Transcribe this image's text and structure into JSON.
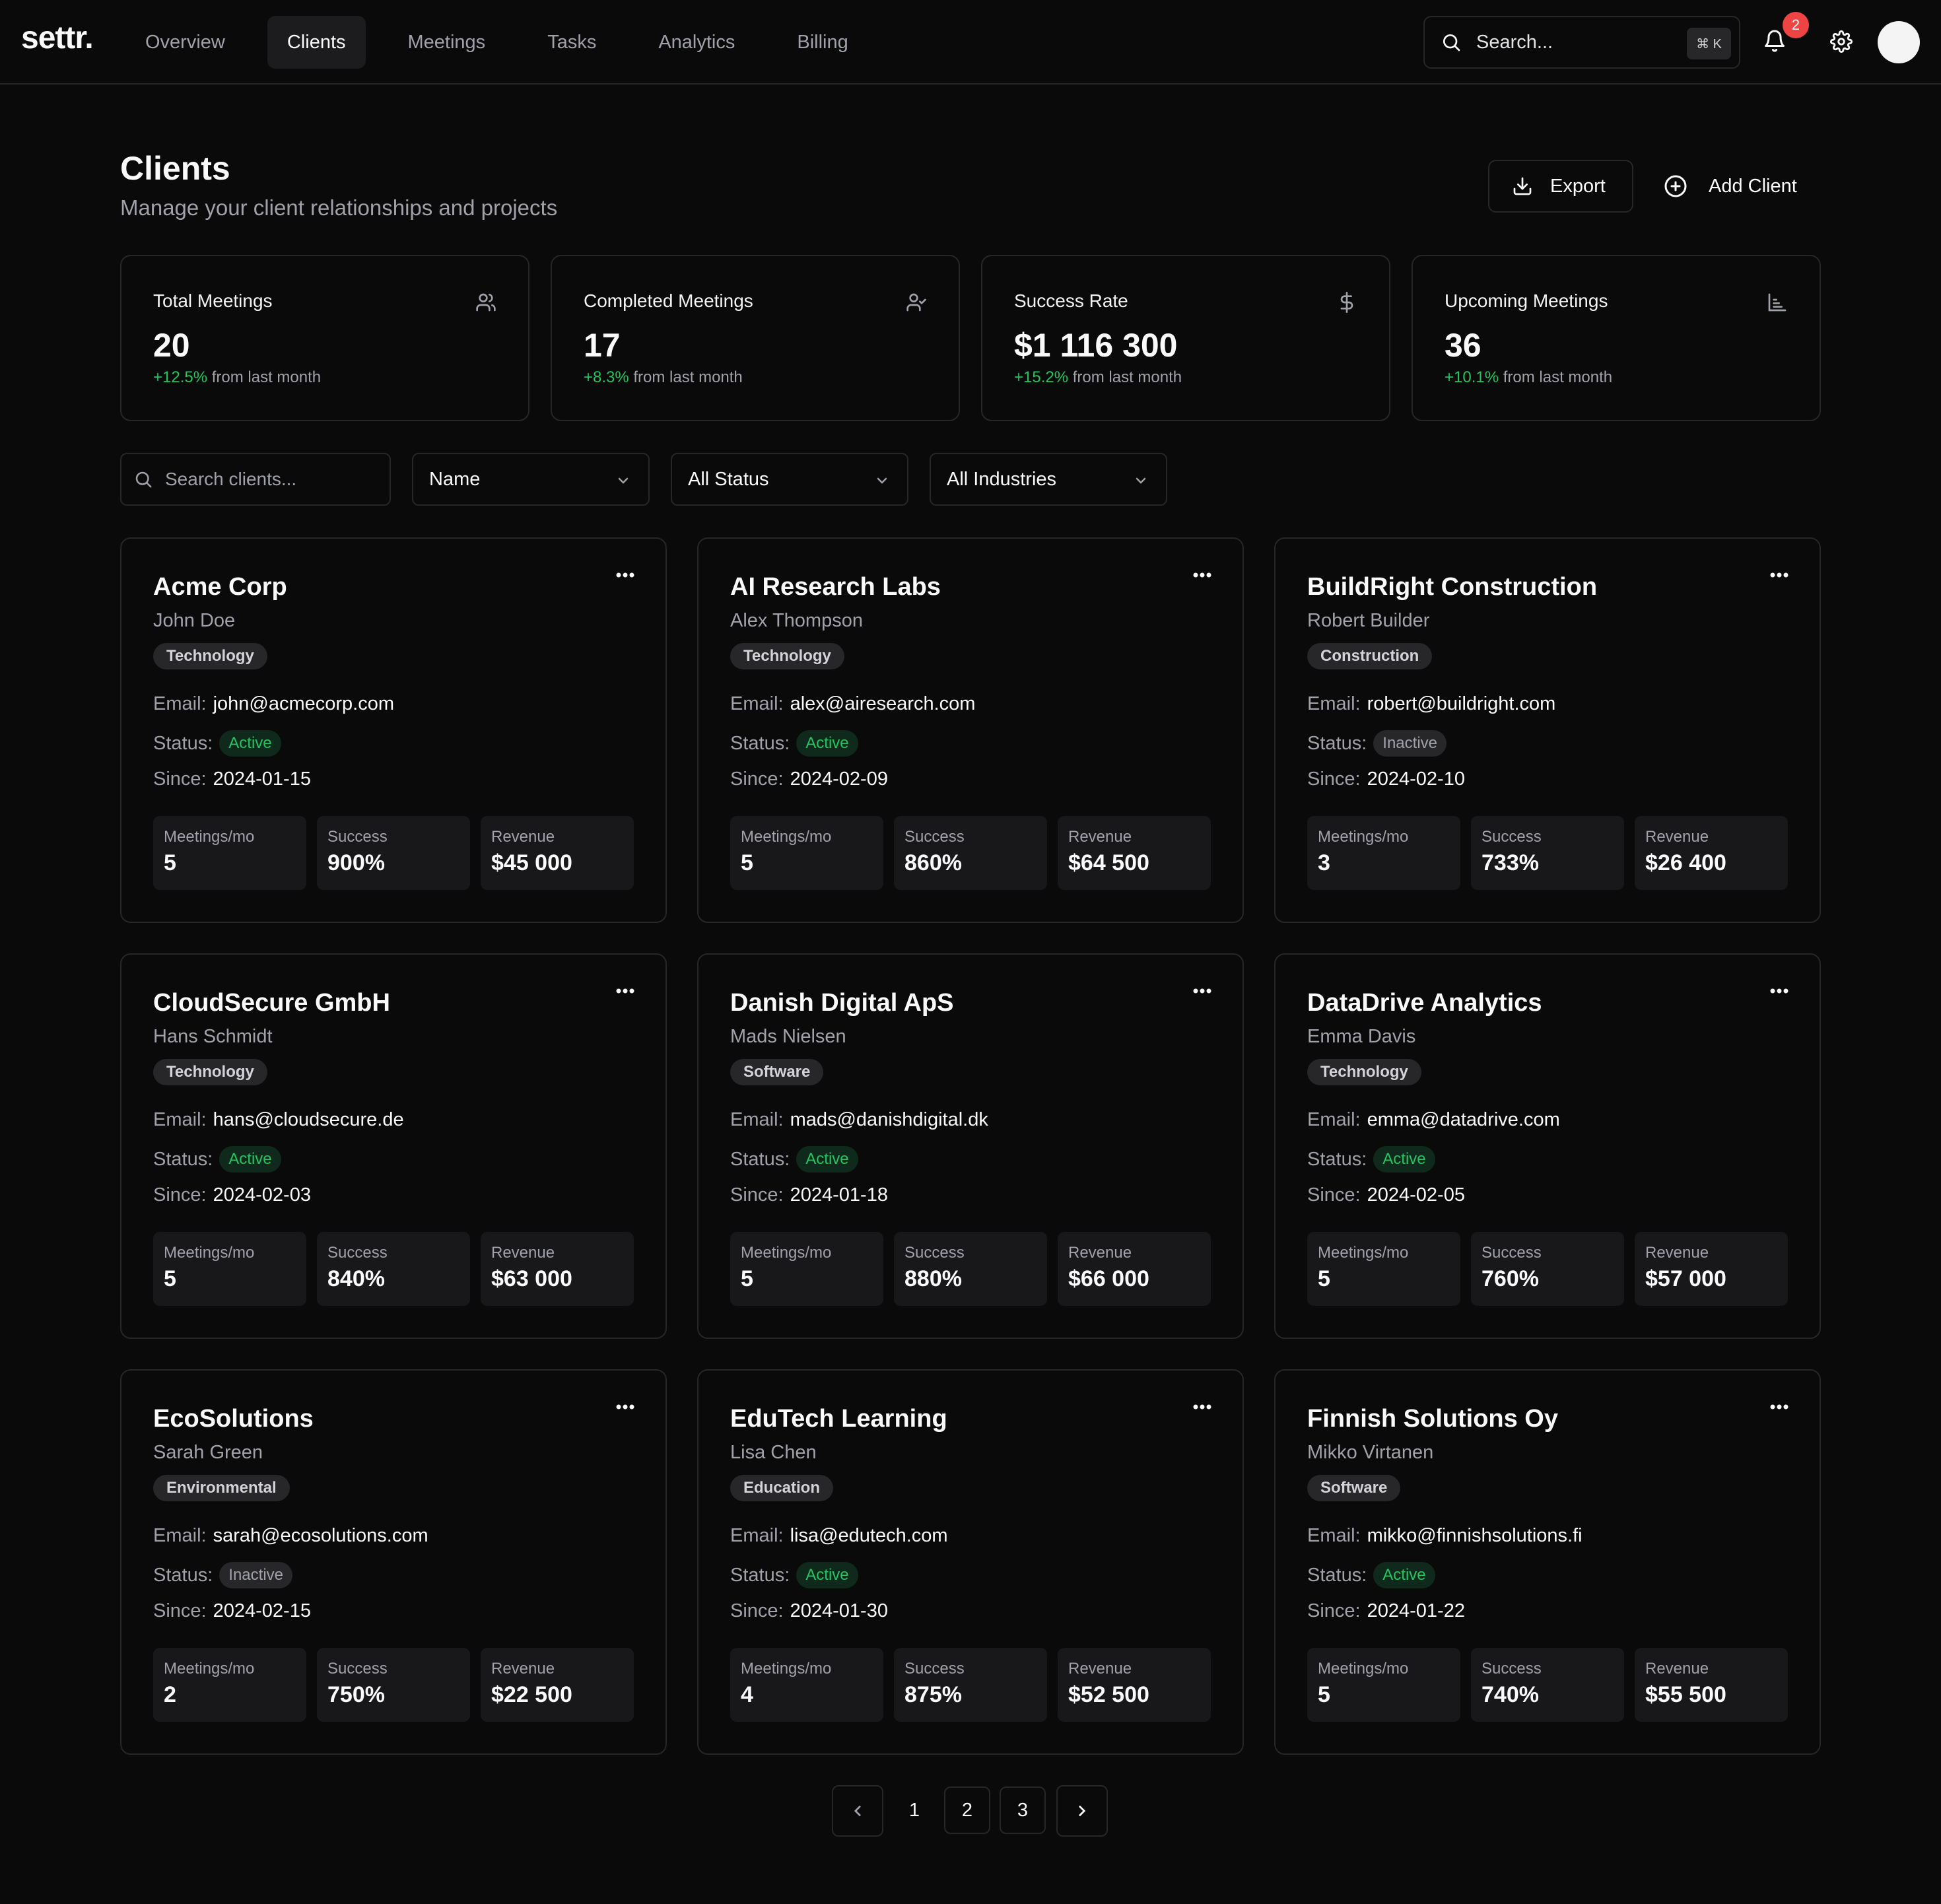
{
  "app": {
    "logo": "settr."
  },
  "nav": {
    "items": [
      {
        "label": "Overview",
        "active": false
      },
      {
        "label": "Clients",
        "active": true
      },
      {
        "label": "Meetings",
        "active": false
      },
      {
        "label": "Tasks",
        "active": false
      },
      {
        "label": "Analytics",
        "active": false
      },
      {
        "label": "Billing",
        "active": false
      }
    ]
  },
  "topbar": {
    "search_placeholder": "Search...",
    "shortcut": "⌘ K",
    "notification_count": "2",
    "icons": [
      "search-icon",
      "bell-icon",
      "gear-icon"
    ]
  },
  "header": {
    "title": "Clients",
    "subtitle": "Manage your client relationships and projects",
    "export_label": "Export",
    "add_label": "Add Client"
  },
  "stats": [
    {
      "label": "Total Meetings",
      "value": "20",
      "change": "+12.5%",
      "suffix": " from last month",
      "icon": "users-icon"
    },
    {
      "label": "Completed Meetings",
      "value": "17",
      "change": "+8.3%",
      "suffix": " from last month",
      "icon": "user-check-icon"
    },
    {
      "label": "Success Rate",
      "value": "$1 116 300",
      "change": "+15.2%",
      "suffix": " from last month",
      "icon": "dollar-icon"
    },
    {
      "label": "Upcoming Meetings",
      "value": "36",
      "change": "+10.1%",
      "suffix": " from last month",
      "icon": "bar-chart-icon"
    }
  ],
  "filters": {
    "search_placeholder": "Search clients...",
    "sort": "Name",
    "status": "All Status",
    "industry": "All Industries"
  },
  "card_labels": {
    "email": "Email:",
    "status": "Status:",
    "since": "Since:",
    "meetings": "Meetings/mo",
    "success": "Success",
    "revenue": "Revenue"
  },
  "clients": [
    {
      "company": "Acme Corp",
      "contact": "John Doe",
      "industry": "Technology",
      "email": "john@acmecorp.com",
      "status": "Active",
      "since": "2024-01-15",
      "meetings": "5",
      "success": "900%",
      "revenue": "$45 000"
    },
    {
      "company": "AI Research Labs",
      "contact": "Alex Thompson",
      "industry": "Technology",
      "email": "alex@airesearch.com",
      "status": "Active",
      "since": "2024-02-09",
      "meetings": "5",
      "success": "860%",
      "revenue": "$64 500"
    },
    {
      "company": "BuildRight Construction",
      "contact": "Robert Builder",
      "industry": "Construction",
      "email": "robert@buildright.com",
      "status": "Inactive",
      "since": "2024-02-10",
      "meetings": "3",
      "success": "733%",
      "revenue": "$26 400"
    },
    {
      "company": "CloudSecure GmbH",
      "contact": "Hans Schmidt",
      "industry": "Technology",
      "email": "hans@cloudsecure.de",
      "status": "Active",
      "since": "2024-02-03",
      "meetings": "5",
      "success": "840%",
      "revenue": "$63 000"
    },
    {
      "company": "Danish Digital ApS",
      "contact": "Mads Nielsen",
      "industry": "Software",
      "email": "mads@danishdigital.dk",
      "status": "Active",
      "since": "2024-01-18",
      "meetings": "5",
      "success": "880%",
      "revenue": "$66 000"
    },
    {
      "company": "DataDrive Analytics",
      "contact": "Emma Davis",
      "industry": "Technology",
      "email": "emma@datadrive.com",
      "status": "Active",
      "since": "2024-02-05",
      "meetings": "5",
      "success": "760%",
      "revenue": "$57 000"
    },
    {
      "company": "EcoSolutions",
      "contact": "Sarah Green",
      "industry": "Environmental",
      "email": "sarah@ecosolutions.com",
      "status": "Inactive",
      "since": "2024-02-15",
      "meetings": "2",
      "success": "750%",
      "revenue": "$22 500"
    },
    {
      "company": "EduTech Learning",
      "contact": "Lisa Chen",
      "industry": "Education",
      "email": "lisa@edutech.com",
      "status": "Active",
      "since": "2024-01-30",
      "meetings": "4",
      "success": "875%",
      "revenue": "$52 500"
    },
    {
      "company": "Finnish Solutions Oy",
      "contact": "Mikko Virtanen",
      "industry": "Software",
      "email": "mikko@finnishsolutions.fi",
      "status": "Active",
      "since": "2024-01-22",
      "meetings": "5",
      "success": "740%",
      "revenue": "$55 500"
    }
  ],
  "pagination": {
    "pages": [
      "1",
      "2",
      "3"
    ],
    "current": "1"
  },
  "colors": {
    "background": "#0a0a0a",
    "border": "#27272a",
    "positive": "#22c55e",
    "badge": "#ef4444"
  }
}
